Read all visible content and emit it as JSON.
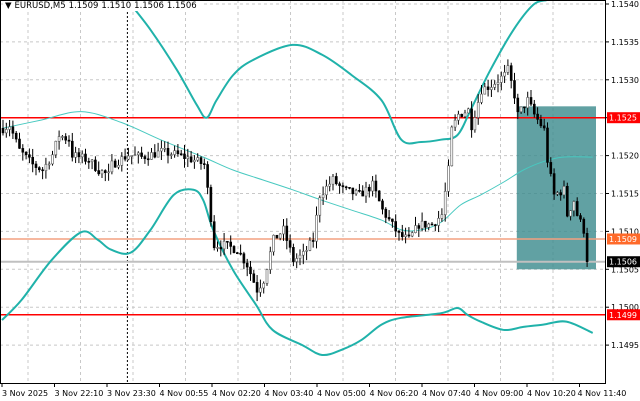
{
  "header": {
    "collapse_icon": "triangle-down-icon",
    "symbol": "EURUSD,M5",
    "open": "1.1509",
    "high": "1.1510",
    "low": "1.1506",
    "close": "1.1506"
  },
  "colors": {
    "background": "#ffffff",
    "bands": "#20b2aa",
    "middle": "#48c9c0",
    "level_red": "#ff0000",
    "level_orange": "#f4a080",
    "bid_line": "#c0c0c0",
    "box": "#3a8a8c",
    "bull": "#ffffff",
    "bear": "#000000"
  },
  "chart_data": {
    "type": "candlestick",
    "title": "EURUSD,M5",
    "ylim": [
      1.14905,
      1.15405
    ],
    "y_ticks": [
      "1.1540",
      "1.1535",
      "1.1530",
      "1.1525",
      "1.1520",
      "1.1515",
      "1.1510",
      "1.1505",
      "1.1500",
      "1.1495"
    ],
    "x_ticks": [
      "3 Nov 2025",
      "3 Nov 22:10",
      "3 Nov 23:30",
      "4 Nov 00:55",
      "4 Nov 02:20",
      "4 Nov 03:40",
      "4 Nov 05:00",
      "4 Nov 06:20",
      "4 Nov 07:40",
      "4 Nov 09:00",
      "4 Nov 10:20",
      "4 Nov 11:40"
    ],
    "bar_count": 178,
    "close_path": [
      [
        0,
        1.15236
      ],
      [
        2,
        1.1524
      ],
      [
        5,
        1.15207
      ],
      [
        9,
        1.15188
      ],
      [
        12,
        1.15181
      ],
      [
        15,
        1.15201
      ],
      [
        17,
        1.15227
      ],
      [
        20,
        1.15221
      ],
      [
        21,
        1.15201
      ],
      [
        26,
        1.15194
      ],
      [
        29,
        1.15181
      ],
      [
        32,
        1.15174
      ],
      [
        33,
        1.15188
      ],
      [
        38,
        1.15201
      ],
      [
        42,
        1.15198
      ],
      [
        48,
        1.15205
      ],
      [
        53,
        1.15201
      ],
      [
        58,
        1.15194
      ],
      [
        61,
        1.15188
      ],
      [
        62,
        1.15155
      ],
      [
        64,
        1.15082
      ],
      [
        67,
        1.15082
      ],
      [
        71,
        1.15076
      ],
      [
        74,
        1.15056
      ],
      [
        77,
        1.15023
      ],
      [
        79,
        1.15036
      ],
      [
        82,
        1.15089
      ],
      [
        85,
        1.15102
      ],
      [
        88,
        1.15062
      ],
      [
        91,
        1.15069
      ],
      [
        94,
        1.15089
      ],
      [
        96,
        1.15148
      ],
      [
        100,
        1.15168
      ],
      [
        103,
        1.15155
      ],
      [
        108,
        1.15148
      ],
      [
        112,
        1.15161
      ],
      [
        115,
        1.15128
      ],
      [
        120,
        1.15095
      ],
      [
        123,
        1.15089
      ],
      [
        126,
        1.15109
      ],
      [
        130,
        1.15109
      ],
      [
        133,
        1.15122
      ],
      [
        135,
        1.15181
      ],
      [
        136,
        1.15234
      ],
      [
        138,
        1.15254
      ],
      [
        141,
        1.1526
      ],
      [
        142,
        1.1524
      ],
      [
        145,
        1.15287
      ],
      [
        148,
        1.15293
      ],
      [
        152,
        1.15306
      ],
      [
        153,
        1.15313
      ],
      [
        155,
        1.1528
      ],
      [
        156,
        1.15254
      ],
      [
        159,
        1.15273
      ],
      [
        161,
        1.15254
      ],
      [
        164,
        1.15234
      ],
      [
        165,
        1.15194
      ],
      [
        167,
        1.15148
      ],
      [
        170,
        1.15155
      ],
      [
        171,
        1.15122
      ],
      [
        173,
        1.15141
      ],
      [
        174,
        1.15122
      ],
      [
        176,
        1.15102
      ],
      [
        177,
        1.1506
      ]
    ],
    "bollinger": {
      "upper": [
        [
          38,
          1.15405
        ],
        [
          45,
          1.15366
        ],
        [
          53,
          1.15313
        ],
        [
          59,
          1.15267
        ],
        [
          62,
          1.1525
        ],
        [
          65,
          1.15273
        ],
        [
          70,
          1.15306
        ],
        [
          76,
          1.15326
        ],
        [
          88,
          1.15346
        ],
        [
          97,
          1.15333
        ],
        [
          106,
          1.15306
        ],
        [
          115,
          1.15273
        ],
        [
          121,
          1.15221
        ],
        [
          127,
          1.15218
        ],
        [
          133,
          1.15221
        ],
        [
          138,
          1.15227
        ],
        [
          142,
          1.1526
        ],
        [
          148,
          1.15313
        ],
        [
          155,
          1.15366
        ],
        [
          161,
          1.15399
        ],
        [
          165,
          1.15405
        ]
      ],
      "middle": [
        [
          0,
          1.15236
        ],
        [
          12,
          1.15247
        ],
        [
          24,
          1.15258
        ],
        [
          36,
          1.15244
        ],
        [
          48,
          1.15221
        ],
        [
          61,
          1.15198
        ],
        [
          70,
          1.15181
        ],
        [
          79,
          1.15168
        ],
        [
          88,
          1.15155
        ],
        [
          97,
          1.15141
        ],
        [
          106,
          1.15128
        ],
        [
          115,
          1.15115
        ],
        [
          121,
          1.15102
        ],
        [
          127,
          1.15102
        ],
        [
          133,
          1.15112
        ],
        [
          139,
          1.15135
        ],
        [
          145,
          1.15148
        ],
        [
          152,
          1.15165
        ],
        [
          158,
          1.15181
        ],
        [
          164,
          1.15192
        ],
        [
          170,
          1.15198
        ],
        [
          179,
          1.15198
        ]
      ],
      "lower": [
        [
          0,
          1.14983
        ],
        [
          6,
          1.1501
        ],
        [
          15,
          1.15062
        ],
        [
          24,
          1.15099
        ],
        [
          29,
          1.15089
        ],
        [
          33,
          1.15076
        ],
        [
          39,
          1.15072
        ],
        [
          45,
          1.15102
        ],
        [
          52,
          1.15148
        ],
        [
          58,
          1.15155
        ],
        [
          61,
          1.15141
        ],
        [
          64,
          1.15102
        ],
        [
          70,
          1.15049
        ],
        [
          77,
          1.15003
        ],
        [
          82,
          1.1497
        ],
        [
          91,
          1.1495
        ],
        [
          97,
          1.14937
        ],
        [
          103,
          1.14944
        ],
        [
          109,
          1.14957
        ],
        [
          115,
          1.14977
        ],
        [
          121,
          1.14986
        ],
        [
          133,
          1.14992
        ],
        [
          138,
          1.14999
        ],
        [
          141,
          1.1499
        ],
        [
          145,
          1.14981
        ],
        [
          152,
          1.1497
        ],
        [
          158,
          1.14974
        ],
        [
          164,
          1.14977
        ],
        [
          171,
          1.14981
        ],
        [
          179,
          1.14966
        ]
      ]
    },
    "levels": [
      {
        "price": 1.1525,
        "label": "1.1525",
        "kind": "resistance"
      },
      {
        "price": 1.1509,
        "label": "1.1509",
        "kind": "open"
      },
      {
        "price": 1.1506,
        "label": "1.1506",
        "kind": "bid"
      },
      {
        "price": 1.1499,
        "label": "1.1499",
        "kind": "support"
      }
    ],
    "vertical_marker_bar": 38,
    "box": {
      "from_bar": 156,
      "to_bar": 180,
      "top": 1.15265,
      "bottom": 1.1505
    }
  }
}
